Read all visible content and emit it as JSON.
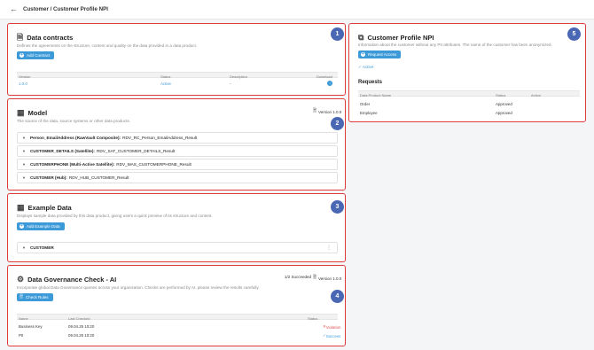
{
  "header": {
    "breadcrumb": "Customer / Customer Profile NPI"
  },
  "contracts": {
    "title": "Data contracts",
    "description": "Defines the agreements on the structure, content and quality on the data provided in a data product.",
    "add_button": "Add Contract",
    "badge": "1",
    "columns": [
      "Version",
      "Status",
      "Description",
      "Download"
    ],
    "rows": [
      {
        "version": "1.0.0",
        "status": "Active",
        "description": "-",
        "download": "download-icon"
      }
    ]
  },
  "model": {
    "title": "Model",
    "description": "The source of the data, source systems or other data products.",
    "version": "Version 1.0.0",
    "badge": "2",
    "items": [
      {
        "name": "Person_EmailAddress (RawVault Composite):",
        "value": "RDV_RC_Person_EmailAddress_Result"
      },
      {
        "name": "CUSTOMER_DETAILS (Satellite):",
        "value": "RDV_SAT_CUSTOMER_DETAILS_Result"
      },
      {
        "name": "CUSTOMERPHONE (Multi-Active Satellite):",
        "value": "RDV_MAS_CUSTOMERPHONE_Result"
      },
      {
        "name": "CUSTOMER (Hub):",
        "value": "RDV_HUB_CUSTOMER_Result"
      }
    ]
  },
  "example": {
    "title": "Example Data",
    "description": "Displays sample data provided by this data product, giving users a quick preview of its structure and content.",
    "add_button": "Add Example Data",
    "badge": "3",
    "items": [
      {
        "name": "CUSTOMER"
      }
    ]
  },
  "governance": {
    "title": "Data Governance Check - AI",
    "description": "Incorporate global Data Governance queries across your organization. Checks are performed by AI, please review the results carefully.",
    "check_button": "Check Rules",
    "succeeded": "1/2 Succeeded",
    "version": "Version 1.0.0",
    "badge": "4",
    "columns": [
      "Name",
      "Last Checked",
      "Status"
    ],
    "rows": [
      {
        "name": "Business Key",
        "last_checked": "09.04.25 10:20",
        "status": "Violation",
        "ok": false
      },
      {
        "name": "PII",
        "last_checked": "09.04.25 10:20",
        "status": "Success",
        "ok": true
      }
    ]
  },
  "npi": {
    "title": "Customer Profile NPI",
    "description": "Information about the customer without any PII attributes. The name of the customer has been anonymized.",
    "request_button": "Request Access",
    "status": "Active",
    "badge": "5",
    "requests_title": "Requests",
    "columns": [
      "Data Product Name",
      "Status",
      "Action"
    ],
    "rows": [
      {
        "name": "Order",
        "status": "Approved"
      },
      {
        "name": "Employee",
        "status": "Approved"
      }
    ]
  },
  "colors": {
    "accent": "#3d9ad8",
    "highlight_border": "#e03a3a",
    "badge": "#4a67b4"
  }
}
